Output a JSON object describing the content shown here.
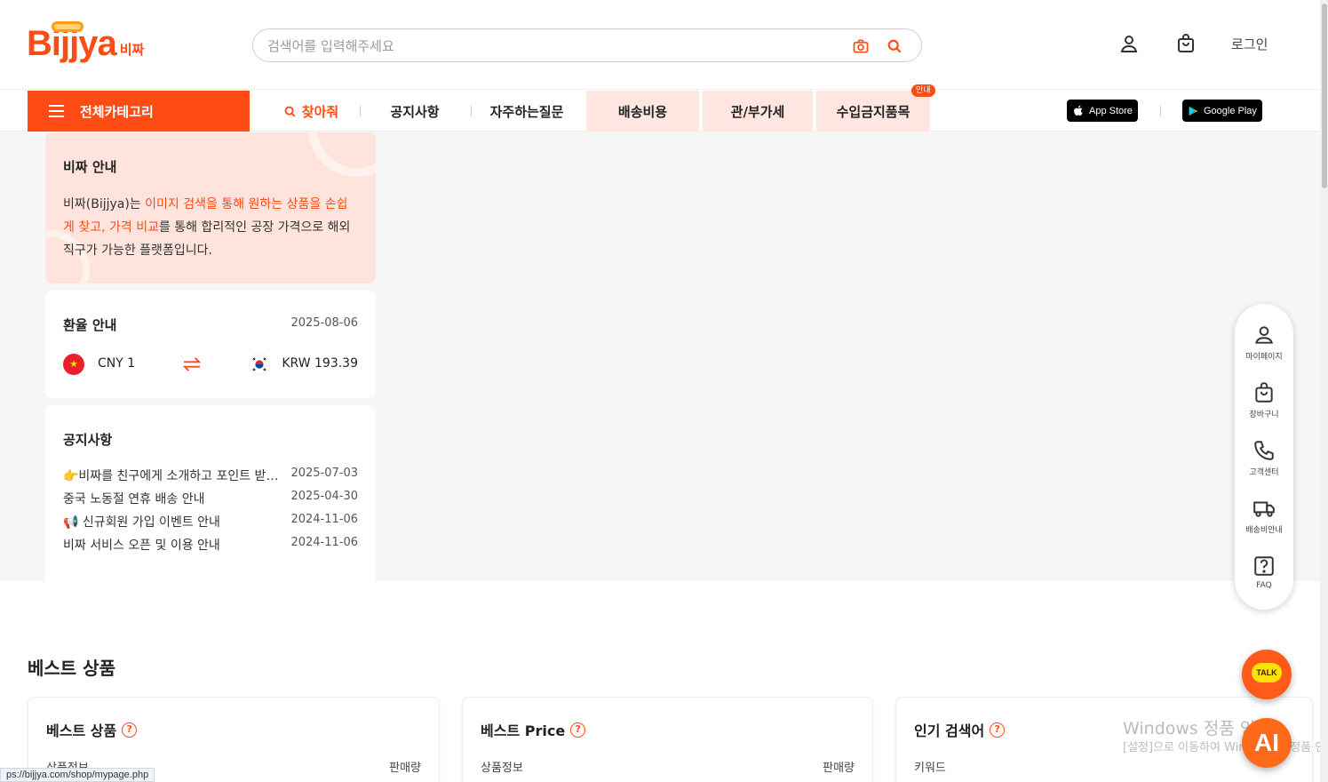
{
  "header": {
    "logo_text": "Bijjya",
    "logo_sub": "비짜",
    "search_placeholder": "검색어를 입력해주세요",
    "login_label": "로그인"
  },
  "nav": {
    "category_label": "전체카테고리",
    "items": [
      {
        "label": "찾아줘"
      },
      {
        "label": "공지사항"
      },
      {
        "label": "자주하는질문"
      },
      {
        "label": "배송비용"
      },
      {
        "label": "관/부가세"
      },
      {
        "label": "수입금지품목"
      }
    ],
    "badge": "안내",
    "app_store": "App Store",
    "google_play": "Google Play"
  },
  "intro": {
    "title": "비짜 안내",
    "text_1": "비짜(Bijjya)는 ",
    "text_hl1": "이미지 검색을 통해 원하는 상품을 손쉽게 찾고, 가격 비교",
    "text_2": "를 통해 합리적인 공장 가격으로 해외 직구가 가능한 플랫폼입니다."
  },
  "exchange": {
    "title": "환율 안내",
    "date": "2025-08-06",
    "from": "CNY 1",
    "to": "KRW 193.39"
  },
  "notice": {
    "title": "공지사항",
    "rows": [
      {
        "title": "👉비짜를 친구에게 소개하고 포인트 받으세요",
        "date": "2025-07-03"
      },
      {
        "title": "중국 노동절 연휴 배송 안내",
        "date": "2025-04-30"
      },
      {
        "title": "📢 신규회원 가입 이벤트 안내",
        "date": "2024-11-06"
      },
      {
        "title": "비짜 서비스 오픈 및 이용 안내",
        "date": "2024-11-06"
      }
    ]
  },
  "best": {
    "section_title": "베스트 상품",
    "cards": [
      {
        "title": "베스트 상품",
        "col1": "상품정보",
        "col2": "판매량"
      },
      {
        "title": "베스트 Price",
        "col1": "상품정보",
        "col2": "판매량"
      },
      {
        "title": "인기 검색어",
        "col1": "키워드",
        "col2": ""
      }
    ]
  },
  "float_menu": [
    {
      "label": "마이페이지",
      "icon": "user-icon"
    },
    {
      "label": "장바구니",
      "icon": "bag-icon"
    },
    {
      "label": "고객센터",
      "icon": "phone-icon"
    },
    {
      "label": "배송비안내",
      "icon": "truck-icon"
    },
    {
      "label": "FAQ",
      "icon": "question-icon"
    }
  ],
  "talk_label": "TALK",
  "ai_label": "AI",
  "watermark": {
    "line1": "Windows 정품 인증",
    "line2": "[설정]으로 이동하여 Windows를 정품 인증합니다."
  },
  "status_url": "ps://bijjya.com/shop/mypage.php",
  "colors": {
    "accent": "#ff4b14",
    "pink": "#ffe6e1"
  }
}
